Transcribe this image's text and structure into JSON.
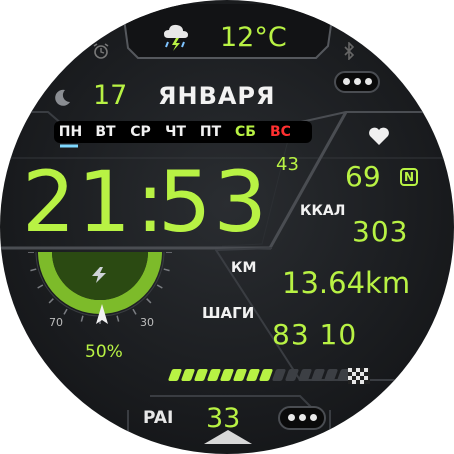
{
  "weather": {
    "icon": "thunderstorm-cloud-icon",
    "temperature": "12°C"
  },
  "date": {
    "day": "17",
    "month": "ЯНВАРЯ"
  },
  "weekdays": [
    {
      "label": "ПН",
      "color": "#f2f2f2"
    },
    {
      "label": "ВТ",
      "color": "#f2f2f2"
    },
    {
      "label": "СР",
      "color": "#f2f2f2"
    },
    {
      "label": "ЧТ",
      "color": "#f2f2f2"
    },
    {
      "label": "ПТ",
      "color": "#f2f2f2"
    },
    {
      "label": "СБ",
      "color": "#b8f244"
    },
    {
      "label": "ВС",
      "color": "#ff3030"
    }
  ],
  "time": {
    "hours": "21",
    "minutes": "53",
    "seconds": "43"
  },
  "heart": {
    "icon": "heart-icon",
    "rate": "69",
    "badge": "N"
  },
  "calories": {
    "label": "ККАЛ",
    "value": "303"
  },
  "distance": {
    "label": "КМ",
    "value": "13.64km"
  },
  "steps": {
    "label": "ШАГИ",
    "value": "83 10"
  },
  "battery": {
    "icon": "lightning-icon",
    "percent": "50%",
    "scale_left": "70",
    "scale_right": "30",
    "level": 0.5
  },
  "progress": {
    "segments_total": 14,
    "segments_filled": 8,
    "end_icon": "checkered-flag-icon"
  },
  "pai": {
    "label": "PAI",
    "value": "33"
  },
  "colors": {
    "accent": "#b8f244",
    "sunday": "#ff3030",
    "background": "#1b1d20"
  }
}
